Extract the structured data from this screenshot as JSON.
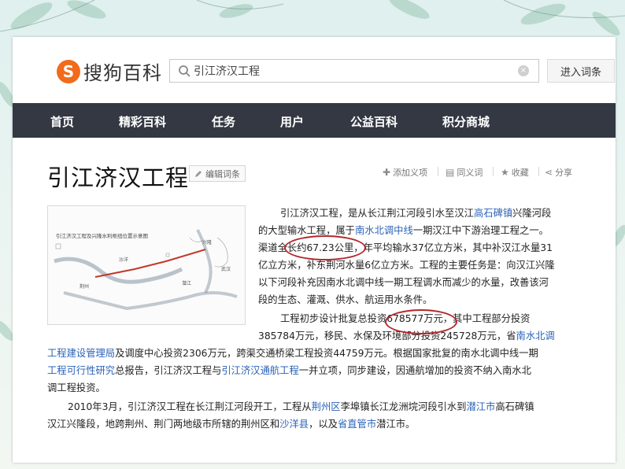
{
  "logo": {
    "mark": "S",
    "text": "搜狗百科"
  },
  "search": {
    "value": "引江济汉工程",
    "clear": "×",
    "button": "进入词条"
  },
  "nav": [
    "首页",
    "精彩百科",
    "任务",
    "用户",
    "公益百科",
    "积分商城"
  ],
  "title": "引江济汉工程",
  "edit_label": "编辑词条",
  "actions": {
    "add_meaning": "添加义项",
    "synonym": "同义词",
    "favorite": "收藏",
    "share": "分享"
  },
  "map_caption": "引江济汉工程及兴隆水利枢纽位置示意图",
  "map_labels": [
    "荆州",
    "武汉",
    "兴隆",
    "潜江",
    "沙洋"
  ],
  "p1": {
    "l1": "引江济汉工程，是从长江荆江河段引水至汉江",
    "l1_link": "高石碑镇",
    "l1_tail": "兴隆河段",
    "l2a": "的大型输水工程，属于",
    "l2_link": "南水北调中线",
    "l2b": "一期汉江中下游治理工程之一。",
    "l3": "渠道全长约67.23公里，年平均输水37亿立方米，其中补汉江水量31",
    "l4": "亿立方米，补东荆河水量6亿立方米。工程的主要任务是：向汉江兴隆",
    "l5": "以下河段补充因南水北调中线一期工程调水而减少的水量，改善该河",
    "l6": "段的生态、灌溉、供水、航运用水条件。"
  },
  "p2": {
    "l1": "工程初步设计批复总投资678577万元，其中工程部分投资",
    "l2a": "385784万元，移民、水保及环境部分投资245728万元，省",
    "l2_link": "南水北调",
    "l3_link": "工程建设管理局",
    "l3b": "及调度中心投资2306万元，跨渠交通桥梁工程投资44759万元。根据国家批复的南水北调中线一期",
    "l4_link": "工程可行性研究",
    "l4b": "总报告，引江济汉工程与",
    "l4_link2": "引江济汉通航工程",
    "l4c": "一并立项，同步建设，因通航增加的投资不纳入南水北",
    "l5": "调工程投资。"
  },
  "p3": {
    "l1a": "2010年3月，引江济汉工程在长江荆江河段开工，工程从",
    "l1_link": "荆州区",
    "l1b": "李埠镇长江龙洲垸河段引水到",
    "l1_link2": "潜江市",
    "l1c": "高石碑镇",
    "l2a": "汉江兴隆段，地跨荆州、荆门两地级市所辖的荆州区和",
    "l2_link": "沙洋县",
    "l2b": "，以及",
    "l2_link2": "省直管市",
    "l2c": "潜江市。"
  },
  "colors": {
    "nav_bg": "#333843",
    "link": "#2a63b8",
    "logo": "#f26a1b",
    "annotation": "#b3282d"
  }
}
